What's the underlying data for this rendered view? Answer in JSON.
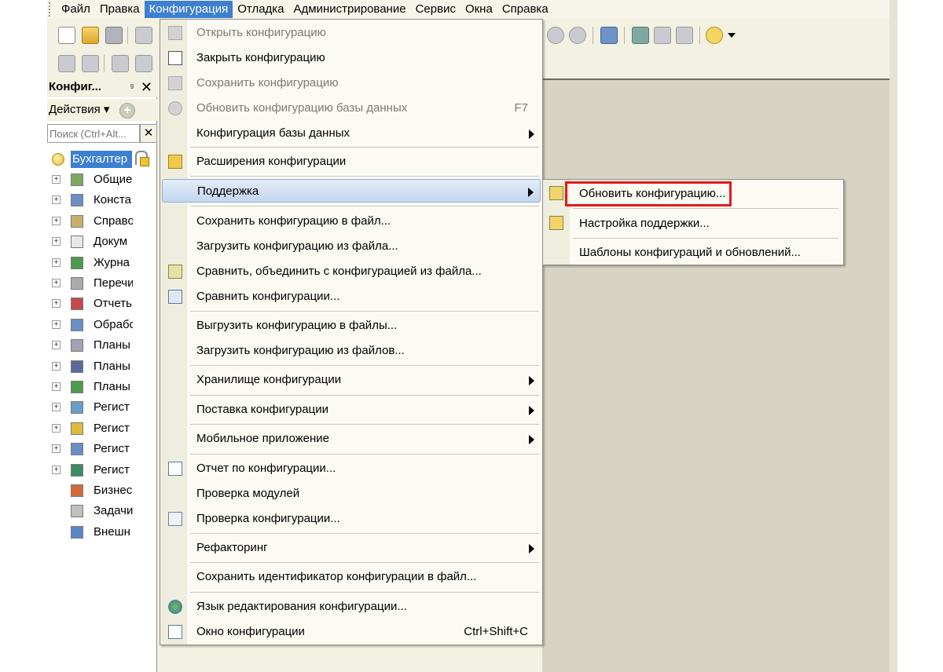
{
  "menubar": {
    "items": [
      "Файл",
      "Правка",
      "Конфигурация",
      "Отладка",
      "Администрирование",
      "Сервис",
      "Окна",
      "Справка"
    ],
    "active_index": 2
  },
  "left_panel": {
    "title": "Конфиг...",
    "pin": "ᵍ",
    "close": "✕",
    "actions_label": "Действия ▾",
    "add_symbol": "+",
    "search_placeholder": "Поиск (Ctrl+Alt...",
    "search_clear": "✕",
    "root_label": "Бухгалтер",
    "items": [
      {
        "label": "Общие",
        "icon": "common-icon"
      },
      {
        "label": "Конста",
        "icon": "constants-icon"
      },
      {
        "label": "Справо",
        "icon": "catalogs-icon"
      },
      {
        "label": "Докум",
        "icon": "documents-icon"
      },
      {
        "label": "Журна",
        "icon": "journals-icon"
      },
      {
        "label": "Перечи",
        "icon": "enums-icon"
      },
      {
        "label": "Отчеть",
        "icon": "reports-icon"
      },
      {
        "label": "Обрабо",
        "icon": "processing-icon"
      },
      {
        "label": "Планы",
        "icon": "plans-icon"
      },
      {
        "label": "Планы",
        "icon": "plans-types-icon"
      },
      {
        "label": "Планы",
        "icon": "plans-accounts-icon"
      },
      {
        "label": "Регист",
        "icon": "registers-icon"
      },
      {
        "label": "Регист",
        "icon": "registers-accum-icon"
      },
      {
        "label": "Регист",
        "icon": "registers-acc-icon"
      },
      {
        "label": "Регист",
        "icon": "registers-calc-icon"
      },
      {
        "label": "Бизнес",
        "icon": "business-icon"
      },
      {
        "label": "Задачи",
        "icon": "tasks-icon"
      },
      {
        "label": "Внешн",
        "icon": "external-icon"
      }
    ]
  },
  "dropdown": {
    "items": [
      {
        "label": "Открыть конфигурацию",
        "disabled": true
      },
      {
        "label": "Закрыть конфигурацию"
      },
      {
        "label": "Сохранить конфигурацию",
        "disabled": true
      },
      {
        "label": "Обновить конфигурацию базы данных",
        "shortcut": "F7",
        "disabled": true
      },
      {
        "label": "Конфигурация базы данных"
      },
      {
        "label": "Расширения конфигурации"
      },
      {
        "label": "Поддержка"
      },
      {
        "label": "Сохранить конфигурацию в файл..."
      },
      {
        "label": "Загрузить конфигурацию из файла..."
      },
      {
        "label": "Сравнить, объединить с конфигурацией из файла..."
      },
      {
        "label": "Сравнить конфигурации..."
      },
      {
        "label": "Выгрузить конфигурацию в файлы..."
      },
      {
        "label": "Загрузить конфигурацию из файлов..."
      },
      {
        "label": "Хранилище конфигурации"
      },
      {
        "label": "Поставка конфигурации"
      },
      {
        "label": "Мобильное приложение"
      },
      {
        "label": "Отчет по конфигурации..."
      },
      {
        "label": "Проверка модулей"
      },
      {
        "label": "Проверка конфигурации..."
      },
      {
        "label": "Рефакторинг"
      },
      {
        "label": "Сохранить идентификатор конфигурации в файл..."
      },
      {
        "label": "Язык редактирования конфигурации..."
      },
      {
        "label": "Окно конфигурации",
        "shortcut": "Ctrl+Shift+C"
      }
    ]
  },
  "submenu": {
    "items": [
      {
        "label": "Обновить конфигурацию..."
      },
      {
        "label": "Настройка поддержки..."
      },
      {
        "label": "Шаблоны конфигураций и обновлений..."
      }
    ],
    "highlight_color": "#e21a1a"
  }
}
